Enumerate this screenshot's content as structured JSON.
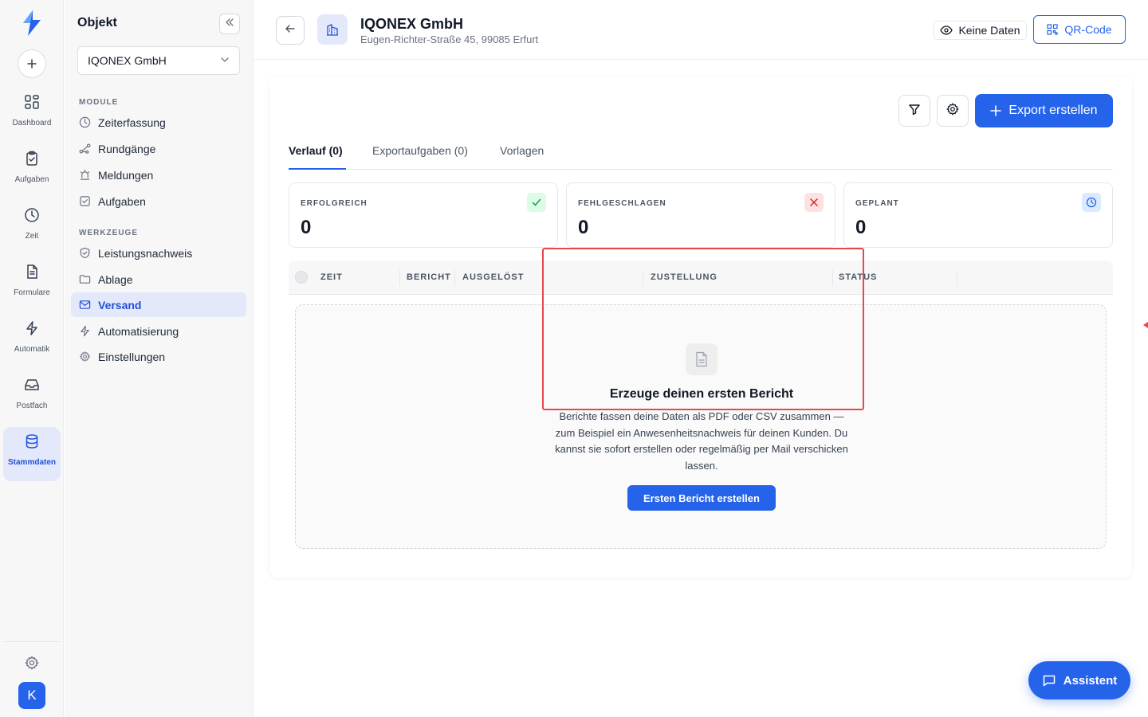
{
  "rail": {
    "items": [
      {
        "label": "Dashboard",
        "icon": "dashboard-icon"
      },
      {
        "label": "Aufgaben",
        "icon": "clipboard-check-icon"
      },
      {
        "label": "Zeit",
        "icon": "clock-icon"
      },
      {
        "label": "Formulare",
        "icon": "document-icon"
      },
      {
        "label": "Automatik",
        "icon": "lightning-icon"
      },
      {
        "label": "Postfach",
        "icon": "inbox-icon"
      },
      {
        "label": "Stammdaten",
        "icon": "database-icon",
        "active": true
      }
    ],
    "avatar_initial": "K"
  },
  "sidebar": {
    "title": "Objekt",
    "selected_object": "IQONEX GmbH",
    "module_label": "MODULE",
    "module_items": [
      {
        "label": "Zeiterfassung",
        "icon": "clock-icon"
      },
      {
        "label": "Rundgänge",
        "icon": "route-icon"
      },
      {
        "label": "Meldungen",
        "icon": "siren-icon"
      },
      {
        "label": "Aufgaben",
        "icon": "checkbox-icon"
      }
    ],
    "tools_label": "WERKZEUGE",
    "tools_items": [
      {
        "label": "Leistungsnachweis",
        "icon": "shield-check-icon"
      },
      {
        "label": "Ablage",
        "icon": "folder-icon"
      },
      {
        "label": "Versand",
        "icon": "mail-icon",
        "active": true
      },
      {
        "label": "Automatisierung",
        "icon": "lightning-icon"
      },
      {
        "label": "Einstellungen",
        "icon": "gear-icon"
      }
    ]
  },
  "header": {
    "title": "IQONEX GmbH",
    "subtitle": "Eugen-Richter-Straße 45, 99085 Erfurt",
    "nodata_label": "Keine Daten",
    "qr_label": "QR-Code"
  },
  "toolbar": {
    "export_label": "Export erstellen"
  },
  "tabs": [
    {
      "label": "Verlauf (0)",
      "active": true
    },
    {
      "label": "Exportaufgaben (0)"
    },
    {
      "label": "Vorlagen"
    }
  ],
  "stats": [
    {
      "label": "ERFOLGREICH",
      "value": "0",
      "icon": "check-icon",
      "color": "#16a34a"
    },
    {
      "label": "FEHLGESCHLAGEN",
      "value": "0",
      "icon": "x-icon",
      "color": "#dc2626"
    },
    {
      "label": "GEPLANT",
      "value": "0",
      "icon": "clock-icon",
      "color": "#2563eb"
    }
  ],
  "table": {
    "columns": [
      "ZEIT",
      "BERICHT",
      "AUSGELÖST",
      "ZUSTELLUNG",
      "STATUS"
    ]
  },
  "empty_state": {
    "title": "Erzeuge deinen ersten Bericht",
    "text": "Berichte fassen deine Daten als PDF oder CSV zusammen — zum Beispiel ein Anwesenheitsnachweis für deinen Kunden. Du kannst sie sofort erstellen oder regelmäßig per Mail verschicken lassen.",
    "button_label": "Ersten Bericht erstellen"
  },
  "assistant": {
    "label": "Assistent"
  },
  "colors": {
    "accent": "#2563eb",
    "active_bg": "#e3e8fb",
    "highlight": "#e5484d"
  }
}
